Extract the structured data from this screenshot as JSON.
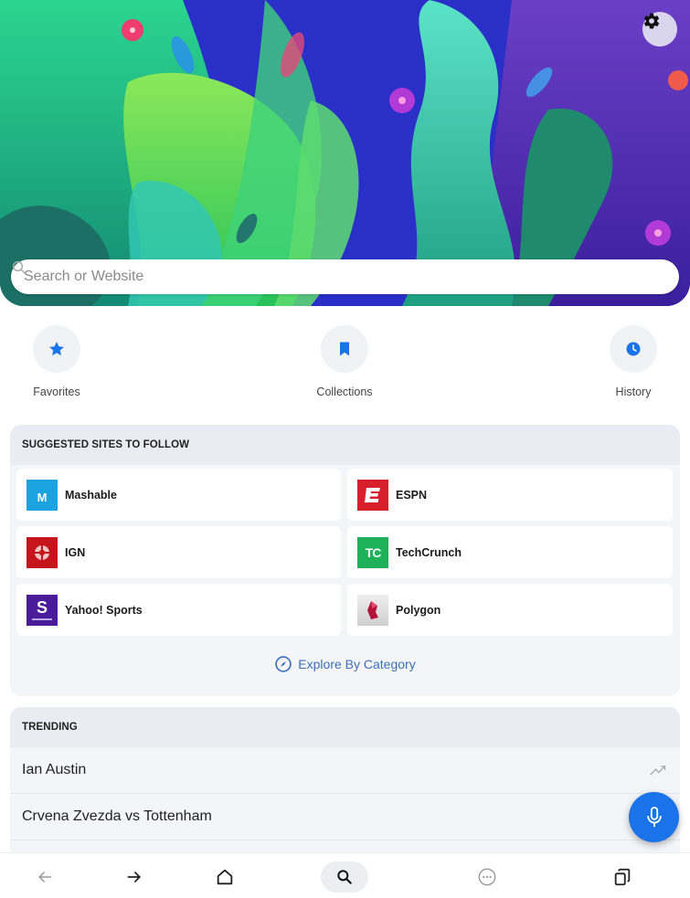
{
  "hero": {
    "settings_icon": "gear-icon"
  },
  "search": {
    "placeholder": "Search or Website",
    "value": "",
    "icon": "search-icon"
  },
  "quick_links": [
    {
      "label": "Favorites",
      "icon": "star-icon"
    },
    {
      "label": "Collections",
      "icon": "bookmark-icon"
    },
    {
      "label": "History",
      "icon": "clock-icon"
    }
  ],
  "suggested": {
    "title": "SUGGESTED SITES TO FOLLOW",
    "sites": [
      {
        "name": "Mashable",
        "logo_letter": "M",
        "color": "#1ba3e0"
      },
      {
        "name": "ESPN",
        "logo_letter": "E",
        "color": "#d8202c"
      },
      {
        "name": "IGN",
        "logo_letter": "",
        "color": "#c4161c"
      },
      {
        "name": "TechCrunch",
        "logo_letter": "TC",
        "color": "#1fb15a"
      },
      {
        "name": "Yahoo! Sports",
        "logo_letter": "S",
        "color": "#4a1c9a"
      },
      {
        "name": "Polygon",
        "logo_letter": "",
        "color": "#b4123a"
      }
    ],
    "explore_label": "Explore By Category"
  },
  "trending": {
    "title": "TRENDING",
    "items": [
      {
        "text": "Ian Austin"
      },
      {
        "text": "Crvena Zvezda vs Tottenham"
      }
    ]
  },
  "fab": {
    "icon": "microphone-icon"
  },
  "bottom_nav": [
    {
      "icon": "back-arrow-icon"
    },
    {
      "icon": "forward-arrow-icon"
    },
    {
      "icon": "home-icon"
    },
    {
      "icon": "search-icon",
      "active": true
    },
    {
      "icon": "more-icon"
    },
    {
      "icon": "tabs-icon"
    }
  ],
  "colors": {
    "accent": "#1a73e8",
    "link": "#3d6fb6"
  }
}
